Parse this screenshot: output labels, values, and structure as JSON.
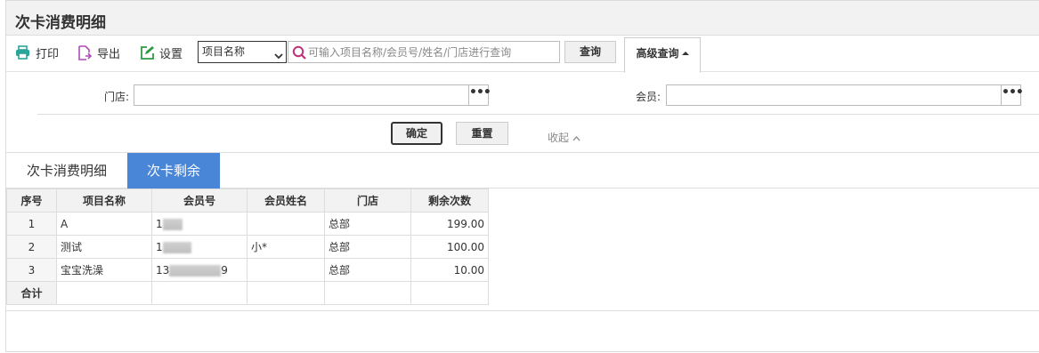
{
  "page": {
    "title": "次卡消费明细"
  },
  "toolbar": {
    "print_label": "打印",
    "export_label": "导出",
    "settings_label": "设置",
    "select_value": "项目名称",
    "search_placeholder": "可输入项目名称/会员号/姓名/门店进行查询",
    "query_label": "查询",
    "advanced_label": "高级查询"
  },
  "filter": {
    "store_label": "门店:",
    "member_label": "会员:",
    "confirm_label": "确定",
    "reset_label": "重置",
    "collapse_label": "收起"
  },
  "tabs": [
    {
      "label": "次卡消费明细",
      "active": false
    },
    {
      "label": "次卡剩余",
      "active": true
    }
  ],
  "table": {
    "columns": [
      "序号",
      "项目名称",
      "会员号",
      "会员姓名",
      "门店",
      "剩余次数"
    ],
    "rows": [
      {
        "index": "1",
        "item": "A",
        "member_no": "1",
        "member_name": "",
        "store": "总部",
        "remaining": "199.00"
      },
      {
        "index": "2",
        "item": "测试",
        "member_no": "1",
        "member_name": "小*",
        "store": "总部",
        "remaining": "100.00"
      },
      {
        "index": "3",
        "item": "宝宝洗澡",
        "member_no": "13",
        "member_no_tail": "9",
        "member_name": "",
        "store": "总部",
        "remaining": "10.00"
      }
    ],
    "total_label": "合计"
  },
  "colors": {
    "accent": "#4a86d8",
    "print_icon": "#2aa59a",
    "export_icon": "#b04ab8",
    "settings_icon": "#2f9a45",
    "search_icon": "#c2307a"
  }
}
